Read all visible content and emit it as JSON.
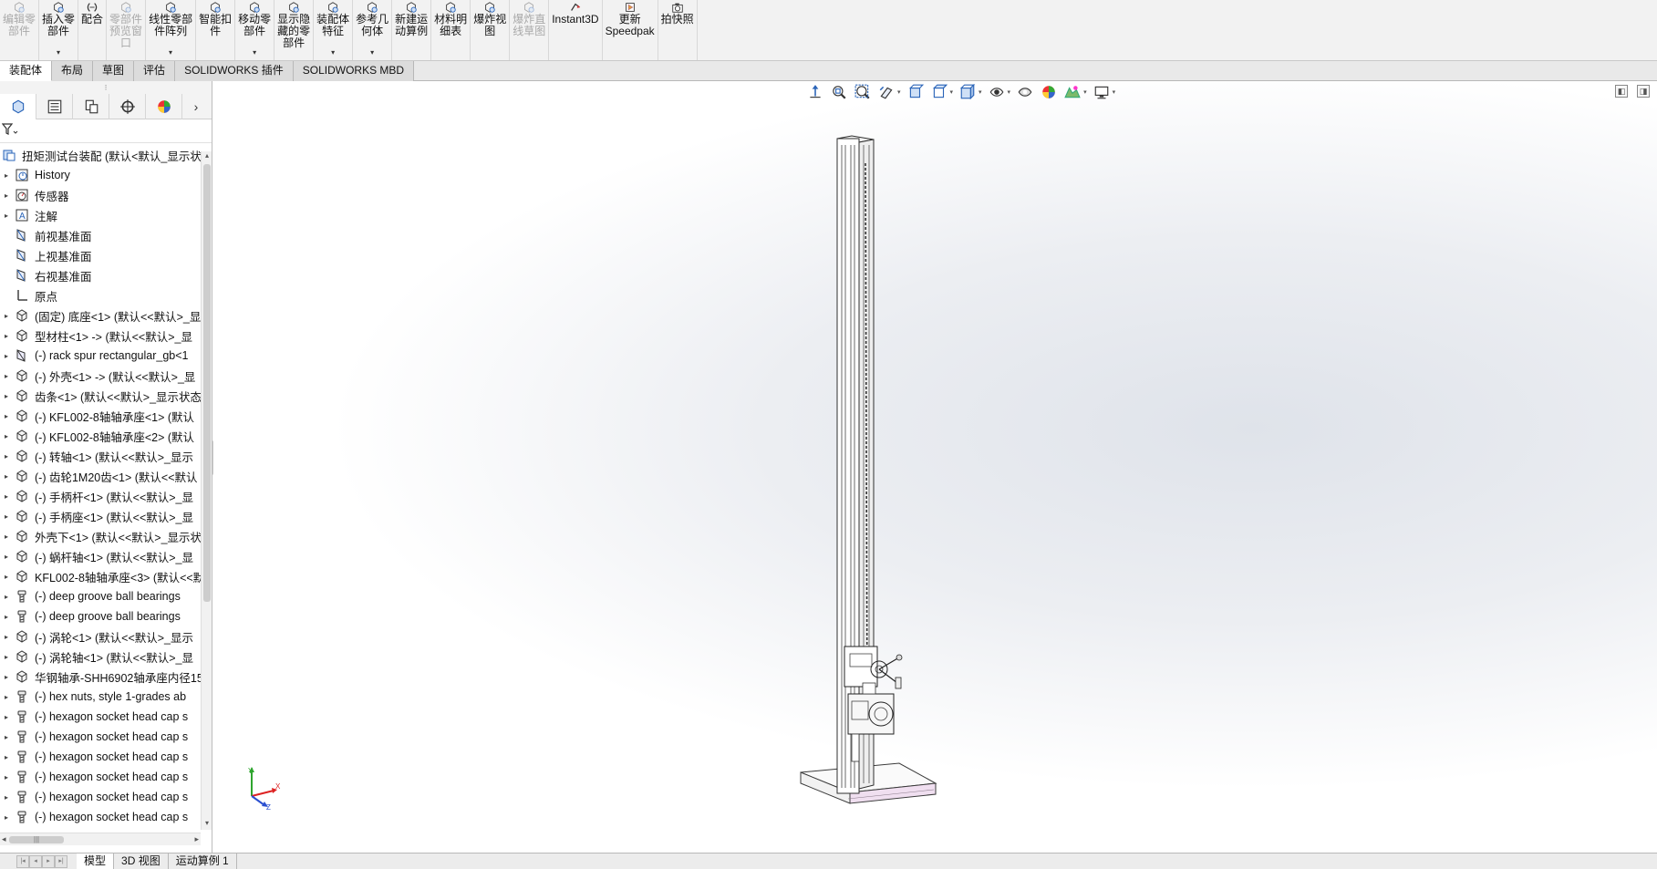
{
  "ribbon": {
    "buttons": [
      {
        "label": "编辑零\n部件",
        "icon": "edit-component-icon",
        "disabled": true,
        "caret": false
      },
      {
        "label": "插入零\n部件",
        "icon": "insert-component-icon",
        "disabled": false,
        "caret": true
      },
      {
        "label": "配合",
        "icon": "mate-icon",
        "disabled": false,
        "caret": false
      },
      {
        "label": "零部件\n预览窗\n口",
        "icon": "component-preview-icon",
        "disabled": true,
        "caret": false
      },
      {
        "label": "线性零部\n件阵列",
        "icon": "linear-pattern-icon",
        "disabled": false,
        "caret": true
      },
      {
        "label": "智能扣\n件",
        "icon": "smart-fastener-icon",
        "disabled": false,
        "caret": false
      },
      {
        "label": "移动零\n部件",
        "icon": "move-component-icon",
        "disabled": false,
        "caret": true
      },
      {
        "label": "显示隐\n藏的零\n部件",
        "icon": "show-hidden-icon",
        "disabled": false,
        "caret": false
      },
      {
        "label": "装配体\n特征",
        "icon": "assembly-feature-icon",
        "disabled": false,
        "caret": true
      },
      {
        "label": "参考几\n何体",
        "icon": "reference-geometry-icon",
        "disabled": false,
        "caret": true
      },
      {
        "label": "新建运\n动算例",
        "icon": "new-motion-study-icon",
        "disabled": false,
        "caret": false
      },
      {
        "label": "材料明\n细表",
        "icon": "bom-icon",
        "disabled": false,
        "caret": false
      },
      {
        "label": "爆炸视\n图",
        "icon": "exploded-view-icon",
        "disabled": false,
        "caret": false
      },
      {
        "label": "爆炸直\n线草图",
        "icon": "explode-line-sketch-icon",
        "disabled": true,
        "caret": false
      },
      {
        "label": "Instant3D",
        "icon": "instant3d-icon",
        "disabled": false,
        "caret": false
      },
      {
        "label": "更新\nSpeedpak",
        "icon": "speedpak-icon",
        "disabled": false,
        "caret": false
      },
      {
        "label": "拍快照",
        "icon": "camera-icon",
        "disabled": false,
        "caret": false
      }
    ]
  },
  "command_tabs": [
    {
      "label": "装配体",
      "active": true
    },
    {
      "label": "布局",
      "active": false
    },
    {
      "label": "草图",
      "active": false
    },
    {
      "label": "评估",
      "active": false
    },
    {
      "label": "SOLIDWORKS 插件",
      "active": false
    },
    {
      "label": "SOLIDWORKS MBD",
      "active": false
    }
  ],
  "panel": {
    "tabs": [
      "feature-manager-icon",
      "property-manager-icon",
      "configuration-manager-icon",
      "dimxpert-icon",
      "display-manager-icon"
    ],
    "more": "›",
    "grip": "⁝"
  },
  "tree": [
    {
      "label": "扭矩测试台装配 (默认<默认_显示状态",
      "icon": "assembly-icon",
      "root": true
    },
    {
      "label": "History",
      "icon": "history-icon"
    },
    {
      "label": "传感器",
      "icon": "sensor-icon"
    },
    {
      "label": "注解",
      "icon": "annotation-icon"
    },
    {
      "label": "前视基准面",
      "icon": "plane-icon",
      "noexp": true
    },
    {
      "label": "上视基准面",
      "icon": "plane-icon",
      "noexp": true
    },
    {
      "label": "右视基准面",
      "icon": "plane-icon",
      "noexp": true
    },
    {
      "label": "原点",
      "icon": "origin-icon",
      "noexp": true
    },
    {
      "label": "(固定) 底座<1> (默认<<默认>_显",
      "icon": "part-icon"
    },
    {
      "label": "型材柱<1> -> (默认<<默认>_显",
      "icon": "part-icon"
    },
    {
      "label": "(-) rack spur rectangular_gb<1",
      "icon": "toolbox-part-icon"
    },
    {
      "label": "(-) 外壳<1> -> (默认<<默认>_显",
      "icon": "part-icon"
    },
    {
      "label": "齿条<1> (默认<<默认>_显示状态",
      "icon": "part-icon"
    },
    {
      "label": "(-) KFL002-8轴轴承座<1> (默认",
      "icon": "part-icon"
    },
    {
      "label": "(-) KFL002-8轴轴承座<2> (默认",
      "icon": "part-icon"
    },
    {
      "label": "(-) 转轴<1> (默认<<默认>_显示",
      "icon": "part-icon"
    },
    {
      "label": "(-) 齿轮1M20齿<1> (默认<<默认",
      "icon": "part-icon"
    },
    {
      "label": "(-) 手柄杆<1> (默认<<默认>_显",
      "icon": "part-icon"
    },
    {
      "label": "(-) 手柄座<1> (默认<<默认>_显",
      "icon": "part-icon"
    },
    {
      "label": "外壳下<1> (默认<<默认>_显示状",
      "icon": "part-icon"
    },
    {
      "label": "(-) 蜗杆轴<1> (默认<<默认>_显",
      "icon": "part-icon"
    },
    {
      "label": "KFL002-8轴轴承座<3> (默认<<默",
      "icon": "part-icon"
    },
    {
      "label": "(-) deep groove ball bearings",
      "icon": "toolbox-fastener-icon"
    },
    {
      "label": "(-) deep groove ball bearings",
      "icon": "toolbox-fastener-icon"
    },
    {
      "label": "(-) 涡轮<1> (默认<<默认>_显示",
      "icon": "part-icon"
    },
    {
      "label": "(-) 涡轮轴<1> (默认<<默认>_显",
      "icon": "part-icon"
    },
    {
      "label": "华钢轴承-SHH6902轴承座内径15",
      "icon": "part-icon"
    },
    {
      "label": "(-) hex nuts, style 1-grades ab",
      "icon": "toolbox-fastener-icon"
    },
    {
      "label": "(-) hexagon socket head cap s",
      "icon": "toolbox-fastener-icon"
    },
    {
      "label": "(-) hexagon socket head cap s",
      "icon": "toolbox-fastener-icon"
    },
    {
      "label": "(-) hexagon socket head cap s",
      "icon": "toolbox-fastener-icon"
    },
    {
      "label": "(-) hexagon socket head cap s",
      "icon": "toolbox-fastener-icon"
    },
    {
      "label": "(-) hexagon socket head cap s",
      "icon": "toolbox-fastener-icon"
    },
    {
      "label": "(-) hexagon socket head cap s",
      "icon": "toolbox-fastener-icon"
    }
  ],
  "scroll": {
    "hthumb": "|||"
  },
  "heads_up_toolbar": [
    "view-orientation-up-icon",
    "zoom-to-fit-icon",
    "zoom-area-icon",
    "previous-view-icon",
    "section-view-icon",
    "dynamic-annotation-icon",
    "view-cube-icon",
    "display-style-icon",
    "hide-show-icon",
    "edit-appearance-icon",
    "apply-scene-icon",
    "view-settings-icon"
  ],
  "window_controls": [
    "◧",
    "◨"
  ],
  "triad": {
    "x": "X",
    "y": "Y",
    "z": "Z"
  },
  "bottom_tabs": [
    {
      "label": "模型",
      "active": true
    },
    {
      "label": "3D 视图",
      "active": false
    },
    {
      "label": "运动算例 1",
      "active": false
    }
  ],
  "colors": {
    "accent_blue": "#2a64b8",
    "model_edge": "#3a3a3a",
    "model_face": "#ffffff",
    "base_tint": "#f0dff0"
  }
}
